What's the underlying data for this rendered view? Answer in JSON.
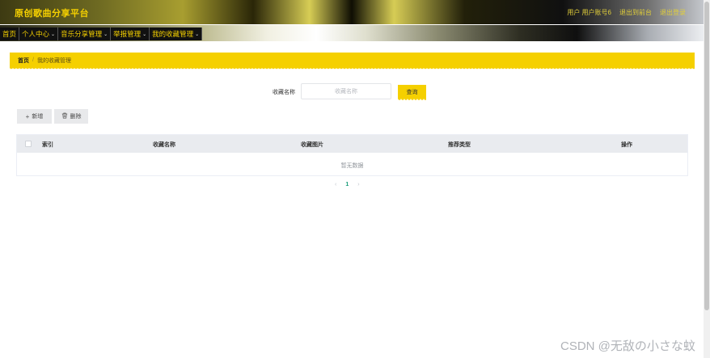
{
  "app": {
    "title": "原创歌曲分享平台"
  },
  "header_links": [
    "用户 用户账号6",
    "退出到前台",
    "退出登录"
  ],
  "menu": [
    {
      "label": "首页",
      "has_dropdown": false
    },
    {
      "label": "个人中心",
      "has_dropdown": true
    },
    {
      "label": "音乐分享管理",
      "has_dropdown": true
    },
    {
      "label": "举报管理",
      "has_dropdown": true
    },
    {
      "label": "我的收藏管理",
      "has_dropdown": true
    }
  ],
  "breadcrumb": {
    "home": "首页",
    "separator": "/",
    "current": "我的收藏管理"
  },
  "search": {
    "label": "收藏名称",
    "placeholder": "收藏名称",
    "value": "",
    "button": "查询"
  },
  "actions": {
    "add": "新增",
    "delete": "删除"
  },
  "table": {
    "columns": [
      "索引",
      "收藏名称",
      "收藏图片",
      "推荐类型",
      "操作"
    ],
    "rows": [],
    "empty_text": "暂无数据"
  },
  "pagination": {
    "prev": "‹",
    "current_page": "1",
    "next": "›"
  },
  "watermark": "CSDN @无敌の小さな蚊",
  "colors": {
    "accent": "#f5d000",
    "header_dark": "#111111",
    "page_active": "#1a9d7a"
  }
}
